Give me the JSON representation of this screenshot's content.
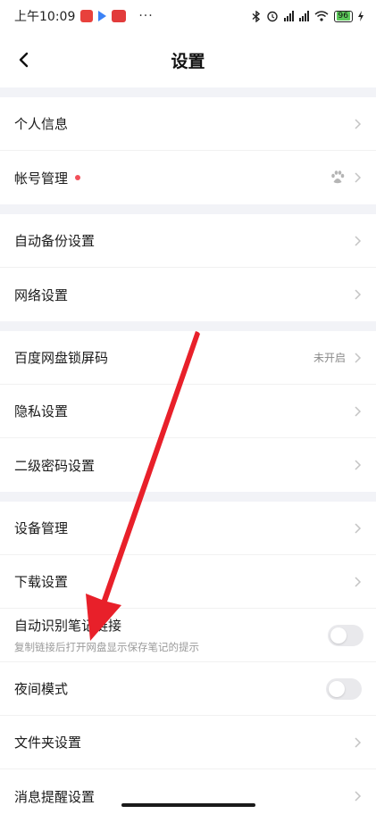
{
  "status_bar": {
    "time": "上午10:09",
    "dots": "···",
    "battery": "96"
  },
  "header": {
    "title": "设置"
  },
  "groups": [
    [
      {
        "label": "个人信息"
      },
      {
        "label": "帐号管理"
      }
    ],
    [
      {
        "label": "自动备份设置"
      },
      {
        "label": "网络设置"
      }
    ],
    [
      {
        "label": "百度网盘锁屏码",
        "value": "未开启"
      },
      {
        "label": "隐私设置"
      },
      {
        "label": "二级密码设置"
      }
    ],
    [
      {
        "label": "设备管理"
      },
      {
        "label": "下载设置"
      },
      {
        "label": "自动识别笔记链接",
        "sub": "复制链接后打开网盘显示保存笔记的提示"
      },
      {
        "label": "夜间模式"
      },
      {
        "label": "文件夹设置"
      },
      {
        "label": "消息提醒设置"
      }
    ]
  ],
  "icons": {
    "back": "back-arrow-icon",
    "chevron": "chevron-right-icon",
    "account": "baidu-paw-icon"
  },
  "colors": {
    "gap": "#f2f3f7",
    "notice_dot": "#f2505a",
    "annotation_arrow": "#e8202a"
  }
}
